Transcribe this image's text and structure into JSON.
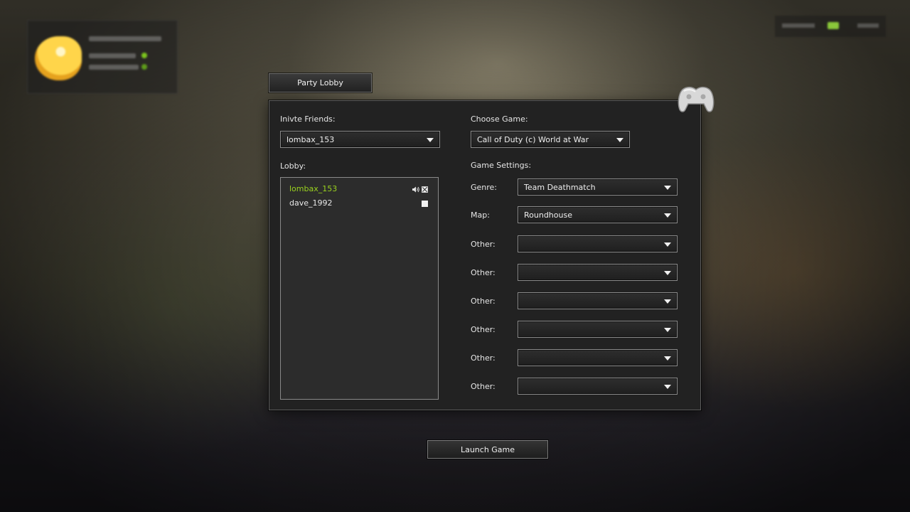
{
  "tab": {
    "label": "Party Lobby"
  },
  "invite": {
    "label": "Inivte Friends:",
    "selected": "lombax_153"
  },
  "lobby": {
    "label": "Lobby:",
    "players": [
      {
        "name": "lombax_153"
      },
      {
        "name": "dave_1992"
      }
    ]
  },
  "game": {
    "label": "Choose Game:",
    "selected": "Call of Duty (c) World at War"
  },
  "settings": {
    "label": "Game Settings:",
    "genre": {
      "label": "Genre:",
      "value": "Team Deathmatch"
    },
    "map": {
      "label": "Map:",
      "value": "Roundhouse"
    },
    "others": [
      {
        "label": "Other:",
        "value": ""
      },
      {
        "label": "Other:",
        "value": ""
      },
      {
        "label": "Other:",
        "value": ""
      },
      {
        "label": "Other:",
        "value": ""
      },
      {
        "label": "Other:",
        "value": ""
      },
      {
        "label": "Other:",
        "value": ""
      }
    ]
  },
  "launch": {
    "label": "Launch Game"
  },
  "colors": {
    "host_name": "#9ad21e",
    "panel_bg": "#222222",
    "border": "#8a8a8a"
  },
  "icons": {
    "controller": "gamepad-icon",
    "voice": "speaker-icon",
    "kick": "close-box-icon",
    "status": "square-icon",
    "dropdown": "chevron-down-icon"
  }
}
